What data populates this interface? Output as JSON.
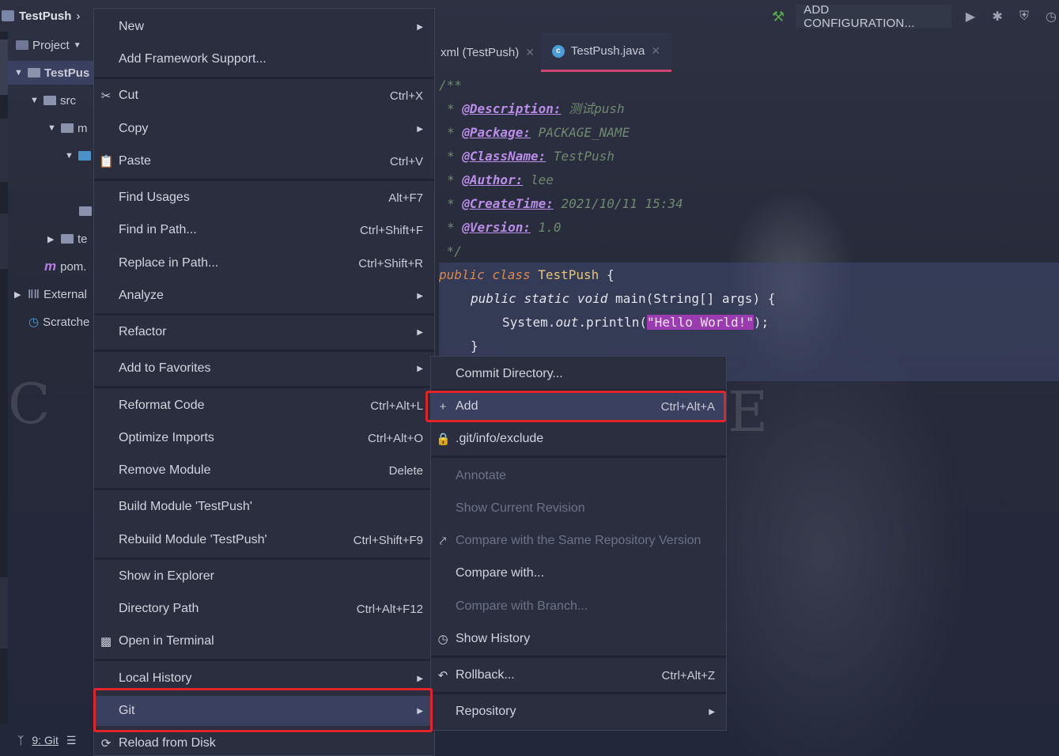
{
  "top_bar": {
    "project_name": "TestPush",
    "breadcrumb_arrow": "›",
    "add_configuration": "ADD CONFIGURATION..."
  },
  "tabs": [
    {
      "label": "xml (TestPush)"
    },
    {
      "label": "TestPush.java"
    }
  ],
  "project_panel": {
    "header": "Project",
    "items": {
      "root": "TestPus",
      "src": "src",
      "main": "m",
      "test": "te",
      "pom": "pom.",
      "external": "External",
      "scratches": "Scratche"
    }
  },
  "code": {
    "l1": "/**",
    "desc_tag": "@Description:",
    "desc_val": " 测试push",
    "pkg_tag": "@Package:",
    "pkg_val": " PACKAGE_NAME",
    "cls_tag": "@ClassName:",
    "cls_val": " TestPush",
    "author_tag": "@Author:",
    "author_val": " lee",
    "time_tag": "@CreateTime:",
    "time_val": " 2021/10/11 15:34",
    "ver_tag": "@Version:",
    "ver_val": " 1.0",
    "end": " */",
    "kw_public": "public",
    "kw_class": "class",
    "class_name": "TestPush",
    "brace_open": "{",
    "kw_static": "static",
    "kw_void": "void",
    "main_sig": "main(String[] args) {",
    "sys": "System.",
    "out": "out",
    "println": ".println(",
    "string": "\"Hello World!\"",
    "call_end": ");",
    "brace_close": "}"
  },
  "context_menu": [
    {
      "label": "New",
      "arrow": "▶"
    },
    {
      "label": "Add Framework Support..."
    },
    {
      "label": "Cut",
      "shortcut": "Ctrl+X",
      "icon": "scissors-icon"
    },
    {
      "label": "Copy",
      "arrow": "▶"
    },
    {
      "label": "Paste",
      "shortcut": "Ctrl+V",
      "icon": "clipboard-icon"
    },
    {
      "label": "Find Usages",
      "shortcut": "Alt+F7"
    },
    {
      "label": "Find in Path...",
      "shortcut": "Ctrl+Shift+F"
    },
    {
      "label": "Replace in Path...",
      "shortcut": "Ctrl+Shift+R"
    },
    {
      "label": "Analyze",
      "arrow": "▶"
    },
    {
      "label": "Refactor",
      "arrow": "▶"
    },
    {
      "label": "Add to Favorites",
      "arrow": "▶"
    },
    {
      "label": "Reformat Code",
      "shortcut": "Ctrl+Alt+L"
    },
    {
      "label": "Optimize Imports",
      "shortcut": "Ctrl+Alt+O"
    },
    {
      "label": "Remove Module",
      "shortcut": "Delete"
    },
    {
      "label": "Build Module 'TestPush'"
    },
    {
      "label": "Rebuild Module 'TestPush'",
      "shortcut": "Ctrl+Shift+F9"
    },
    {
      "label": "Show in Explorer"
    },
    {
      "label": "Directory Path",
      "shortcut": "Ctrl+Alt+F12"
    },
    {
      "label": "Open in Terminal",
      "icon": "terminal-icon"
    },
    {
      "label": "Local History",
      "arrow": "▶"
    },
    {
      "label": "Git",
      "arrow": "▶"
    },
    {
      "label": "Reload from Disk",
      "icon": "reload-icon"
    }
  ],
  "git_submenu": [
    {
      "label": "Commit Directory..."
    },
    {
      "label": "Add",
      "shortcut": "Ctrl+Alt+A",
      "icon": "plus-icon"
    },
    {
      "label": ".git/info/exclude",
      "icon": "file-lock-icon"
    },
    {
      "label": "Annotate",
      "disabled": true
    },
    {
      "label": "Show Current Revision",
      "disabled": true
    },
    {
      "label": "Compare with the Same Repository Version",
      "disabled": true
    },
    {
      "label": "Compare with..."
    },
    {
      "label": "Compare with Branch...",
      "disabled": true
    },
    {
      "label": "Show History",
      "icon": "clock-icon"
    },
    {
      "label": "Rollback...",
      "shortcut": "Ctrl+Alt+Z",
      "icon": "undo-icon"
    },
    {
      "label": "Repository",
      "arrow": "▶"
    }
  ],
  "bottom_bar": {
    "git_label": "9: Git"
  },
  "colors": {
    "highlight_border": "#e0242a",
    "menu_bg": "#2a2e3f",
    "tab_underline": "#d04370"
  }
}
